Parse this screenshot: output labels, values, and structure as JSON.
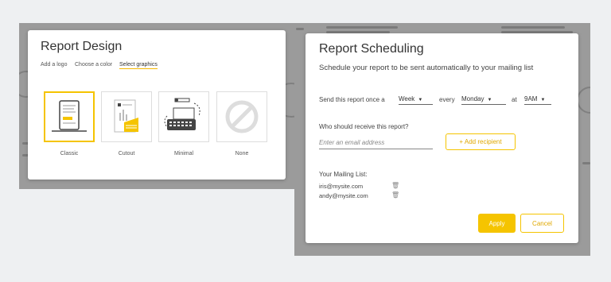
{
  "design": {
    "title": "Report Design",
    "options": [
      "Add a logo",
      "Choose a color",
      "Select graphics"
    ],
    "active_option": "Select graphics",
    "graphics": [
      {
        "label": "Classic",
        "icon": "tablet-icon",
        "selected": true
      },
      {
        "label": "Cutout",
        "icon": "report-cutout-icon",
        "selected": false
      },
      {
        "label": "Minimal",
        "icon": "typewriter-icon",
        "selected": false
      },
      {
        "label": "None",
        "icon": "no-symbol-icon",
        "selected": false
      }
    ]
  },
  "schedule": {
    "title": "Report Scheduling",
    "subtitle": "Schedule your report to be sent automatically to your mailing list",
    "send_prefix": "Send this report once a",
    "frequency": "Week",
    "every_label": "every",
    "day": "Monday",
    "at_label": "at",
    "time": "9AM",
    "recipient_question": "Who should receive this report?",
    "email_placeholder": "Enter an email address",
    "add_recipient_label": "+ Add recipient",
    "mailing_list_title": "Your Mailing List:",
    "mailing_list": [
      "iris@mysite.com",
      "andy@mysite.com"
    ],
    "apply_label": "Apply",
    "cancel_label": "Cancel"
  },
  "colors": {
    "accent": "#f5c400",
    "overlay": "#9b9b9b",
    "page_bg": "#eef0f2"
  }
}
